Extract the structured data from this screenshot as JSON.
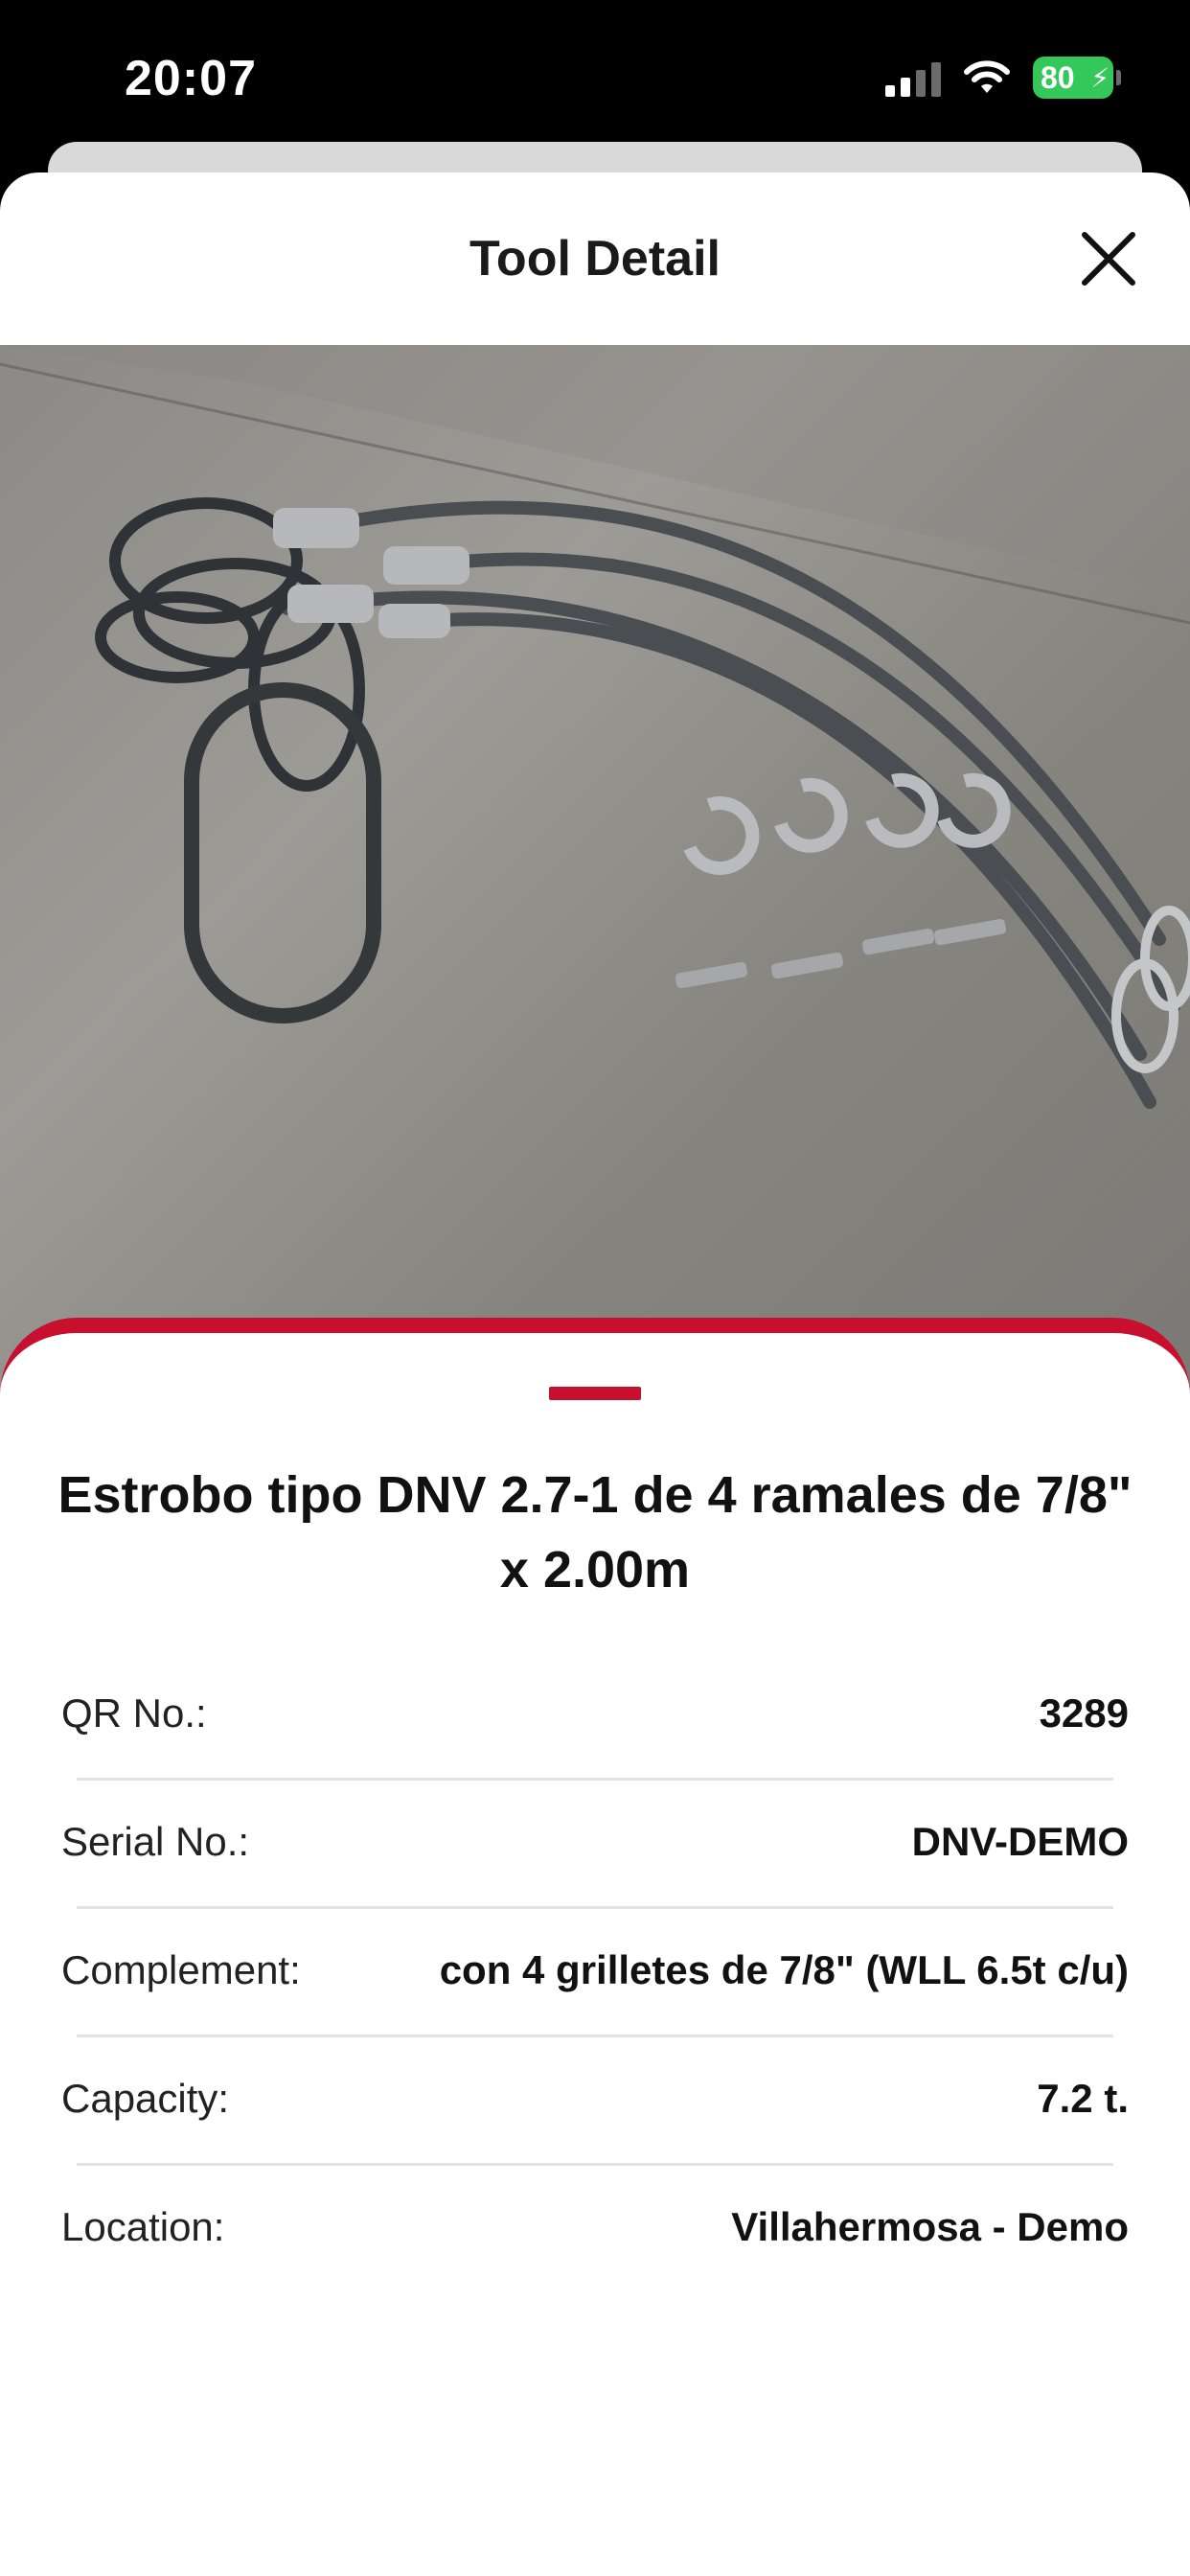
{
  "status_bar": {
    "time": "20:07",
    "battery": "80",
    "colors": {
      "battery": "#34c759"
    }
  },
  "sheet": {
    "title": "Tool Detail",
    "close_icon": "close-icon"
  },
  "tool": {
    "photo_icon": "tool-photo",
    "name": "Estrobo tipo DNV 2.7-1 de 4 ramales de 7/8\" x 2.00m",
    "details": [
      {
        "label": "QR No.:",
        "value": "3289"
      },
      {
        "label": "Serial No.:",
        "value": "DNV-DEMO"
      },
      {
        "label": "Complement:",
        "value": "con 4 grilletes de 7/8\" (WLL 6.5t c/u)"
      },
      {
        "label": "Capacity:",
        "value": "7.2 t."
      },
      {
        "label": "Location:",
        "value": "Villahermosa - Demo"
      }
    ]
  },
  "colors": {
    "accent": "#c8102e"
  }
}
